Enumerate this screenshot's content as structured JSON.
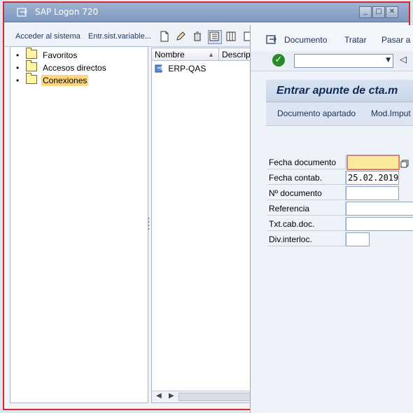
{
  "logon": {
    "title": "SAP Logon 720",
    "menu": {
      "login": "Acceder al sistema",
      "variable": "Entr.sist.variable..."
    },
    "tree": [
      {
        "label": "Favoritos",
        "selected": false
      },
      {
        "label": "Accesos directos",
        "selected": false
      },
      {
        "label": "Conexiones",
        "selected": true
      }
    ],
    "list": {
      "col_name": "Nombre",
      "col_desc": "Descrip",
      "rows": [
        "ERP-QAS"
      ]
    }
  },
  "gui": {
    "menu": [
      {
        "label": "Documento"
      },
      {
        "label": "Tratar"
      },
      {
        "label": "Pasar a"
      }
    ],
    "transaction_title": "Entrar apunte de cta.m",
    "app_buttons": [
      "Documento apartado",
      "Mod.Imput"
    ],
    "fields": [
      {
        "label": "Fecha documento",
        "value": ""
      },
      {
        "label": "Fecha contab.",
        "value": "25.02.2019"
      },
      {
        "label": "Nº documento",
        "value": ""
      },
      {
        "label": "Referencia",
        "value": ""
      },
      {
        "label": "Txt.cab.doc.",
        "value": ""
      },
      {
        "label": "Div.interloc.",
        "value": ""
      }
    ]
  },
  "colors": {
    "accent_border": "#d8262e",
    "focus_field": "#fbe99a",
    "selection": "#ffd680"
  }
}
